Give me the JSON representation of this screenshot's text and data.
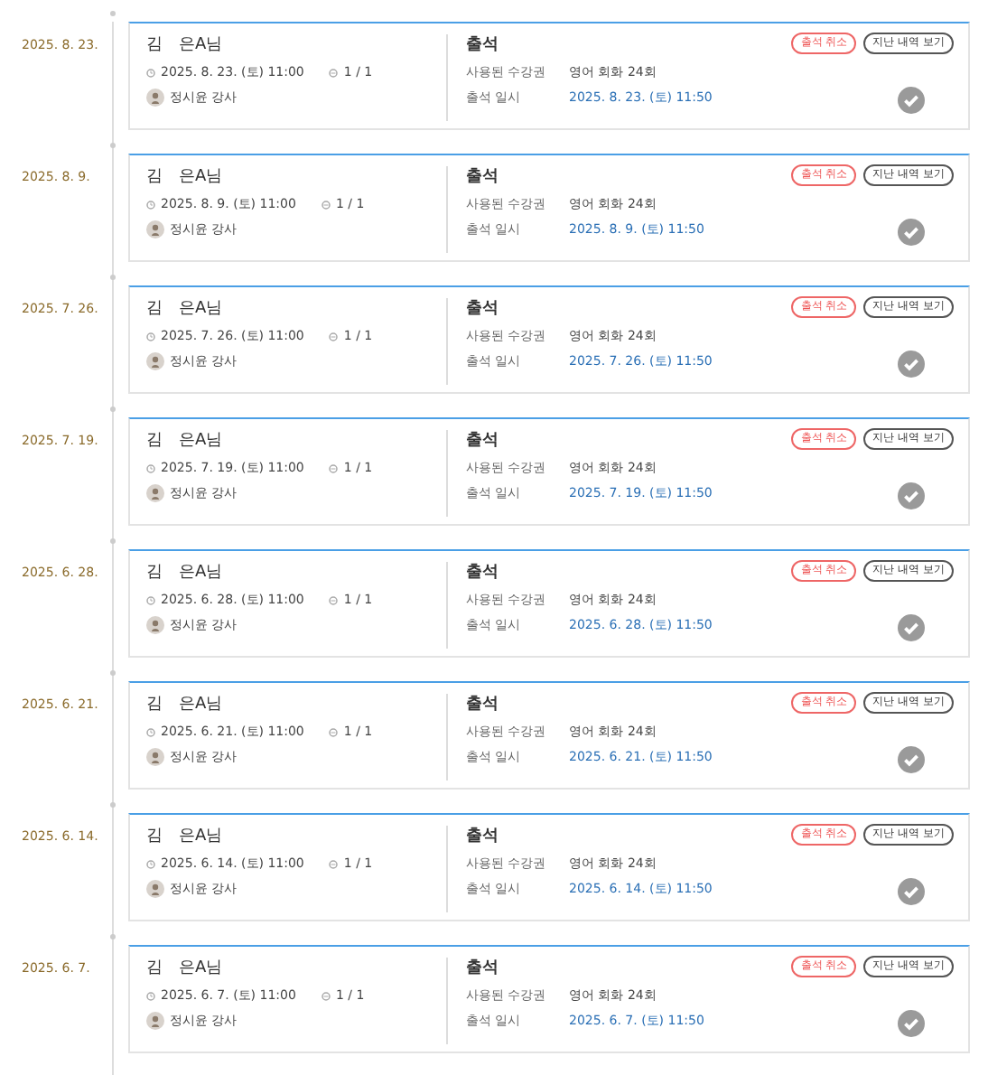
{
  "records": [
    {
      "date": "2025. 8. 23.",
      "name": "김　은A님",
      "class_time": "2025. 8. 23. (토) 11:00",
      "session": "1 / 1",
      "teacher": "정시윤 강사",
      "status": "출석",
      "ticket_label": "사용된 수강권",
      "ticket": "영어 회화 24회",
      "attended_label": "출석 일시",
      "attended_at": "2025. 8. 23. (토) 11:50",
      "buttons": [
        {
          "label": "출석 취소",
          "kind": "danger"
        },
        {
          "label": "지난 내역 보기",
          "kind": "plain"
        }
      ],
      "checked": true
    },
    {
      "date": "2025. 8. 9.",
      "name": "김　은A님",
      "class_time": "2025. 8. 9. (토) 11:00",
      "session": "1 / 1",
      "teacher": "정시윤 강사",
      "status": "출석",
      "ticket_label": "사용된 수강권",
      "ticket": "영어 회화 24회",
      "attended_label": "출석 일시",
      "attended_at": "2025. 8. 9. (토) 11:50",
      "buttons": [
        {
          "label": "출석 취소",
          "kind": "danger"
        },
        {
          "label": "지난 내역 보기",
          "kind": "plain"
        }
      ],
      "checked": true
    },
    {
      "date": "2025. 7. 26.",
      "name": "김　은A님",
      "class_time": "2025. 7. 26. (토) 11:00",
      "session": "1 / 1",
      "teacher": "정시윤 강사",
      "status": "출석",
      "ticket_label": "사용된 수강권",
      "ticket": "영어 회화 24회",
      "attended_label": "출석 일시",
      "attended_at": "2025. 7. 26. (토) 11:50",
      "buttons": [
        {
          "label": "출석 취소",
          "kind": "danger"
        },
        {
          "label": "지난 내역 보기",
          "kind": "plain"
        }
      ],
      "checked": true
    },
    {
      "date": "2025. 7. 19.",
      "name": "김　은A님",
      "class_time": "2025. 7. 19. (토) 11:00",
      "session": "1 / 1",
      "teacher": "정시윤 강사",
      "status": "출석",
      "ticket_label": "사용된 수강권",
      "ticket": "영어 회화 24회",
      "attended_label": "출석 일시",
      "attended_at": "2025. 7. 19. (토) 11:50",
      "buttons": [
        {
          "label": "출석 취소",
          "kind": "danger"
        },
        {
          "label": "지난 내역 보기",
          "kind": "plain"
        }
      ],
      "checked": true
    },
    {
      "date": "2025. 6. 28.",
      "name": "김　은A님",
      "class_time": "2025. 6. 28. (토) 11:00",
      "session": "1 / 1",
      "teacher": "정시윤 강사",
      "status": "출석",
      "ticket_label": "사용된 수강권",
      "ticket": "영어 회화 24회",
      "attended_label": "출석 일시",
      "attended_at": "2025. 6. 28. (토) 11:50",
      "buttons": [
        {
          "label": "출석 취소",
          "kind": "danger"
        },
        {
          "label": "지난 내역 보기",
          "kind": "plain"
        }
      ],
      "checked": true
    },
    {
      "date": "2025. 6. 21.",
      "name": "김　은A님",
      "class_time": "2025. 6. 21. (토) 11:00",
      "session": "1 / 1",
      "teacher": "정시윤 강사",
      "status": "출석",
      "ticket_label": "사용된 수강권",
      "ticket": "영어 회화 24회",
      "attended_label": "출석 일시",
      "attended_at": "2025. 6. 21. (토) 11:50",
      "buttons": [
        {
          "label": "출석 취소",
          "kind": "danger"
        },
        {
          "label": "지난 내역 보기",
          "kind": "plain"
        }
      ],
      "checked": true
    },
    {
      "date": "2025. 6. 14.",
      "name": "김　은A님",
      "class_time": "2025. 6. 14. (토) 11:00",
      "session": "1 / 1",
      "teacher": "정시윤 강사",
      "status": "출석",
      "ticket_label": "사용된 수강권",
      "ticket": "영어 회화 24회",
      "attended_label": "출석 일시",
      "attended_at": "2025. 6. 14. (토) 11:50",
      "buttons": [
        {
          "label": "출석 취소",
          "kind": "danger"
        },
        {
          "label": "지난 내역 보기",
          "kind": "plain"
        }
      ],
      "checked": true
    },
    {
      "date": "2025. 6. 7.",
      "name": "김　은A님",
      "class_time": "2025. 6. 7. (토) 11:00",
      "session": "1 / 1",
      "teacher": "정시윤 강사",
      "status": "출석",
      "ticket_label": "사용된 수강권",
      "ticket": "영어 회화 24회",
      "attended_label": "출석 일시",
      "attended_at": "2025. 6. 7. (토) 11:50",
      "buttons": [
        {
          "label": "출석 취소",
          "kind": "danger"
        },
        {
          "label": "지난 내역 보기",
          "kind": "plain"
        }
      ],
      "checked": true
    }
  ]
}
